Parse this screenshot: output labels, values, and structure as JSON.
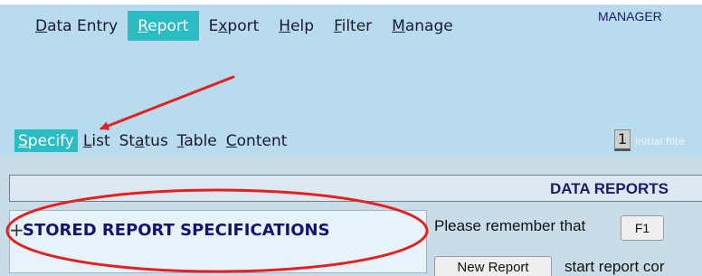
{
  "menu": {
    "items": [
      {
        "pre": "",
        "u": "D",
        "post": "ata Entry"
      },
      {
        "pre": "",
        "u": "R",
        "post": "eport"
      },
      {
        "pre": "E",
        "u": "x",
        "post": "port"
      },
      {
        "pre": "",
        "u": "H",
        "post": "elp"
      },
      {
        "pre": "",
        "u": "F",
        "post": "ilter"
      },
      {
        "pre": "",
        "u": "M",
        "post": "anage"
      }
    ],
    "active_index": 1
  },
  "manager_label": "MANAGER",
  "submenu": {
    "items": [
      {
        "pre": "",
        "u": "S",
        "post": "pecify"
      },
      {
        "pre": "",
        "u": "L",
        "post": "ist"
      },
      {
        "pre": "St",
        "u": "a",
        "post": "tus"
      },
      {
        "pre": "",
        "u": "T",
        "post": "able"
      },
      {
        "pre": "",
        "u": "C",
        "post": "ontent"
      }
    ],
    "active_index": 0
  },
  "page_indicator": "1",
  "initial_filter_text": "Initial filte",
  "data_reports_title": "DATA REPORTS",
  "stored_panel": {
    "expander": "+",
    "label": "STORED REPORT SPECIFICATIONS"
  },
  "remember_text": "Please remember that",
  "f1_key_label": "F1",
  "new_report_button": "New Report",
  "start_report_text": "start report cor",
  "colors": {
    "active_tab": "#2bbcc4",
    "header_bg": "#b8dcee",
    "annotation_red": "#e62020"
  }
}
